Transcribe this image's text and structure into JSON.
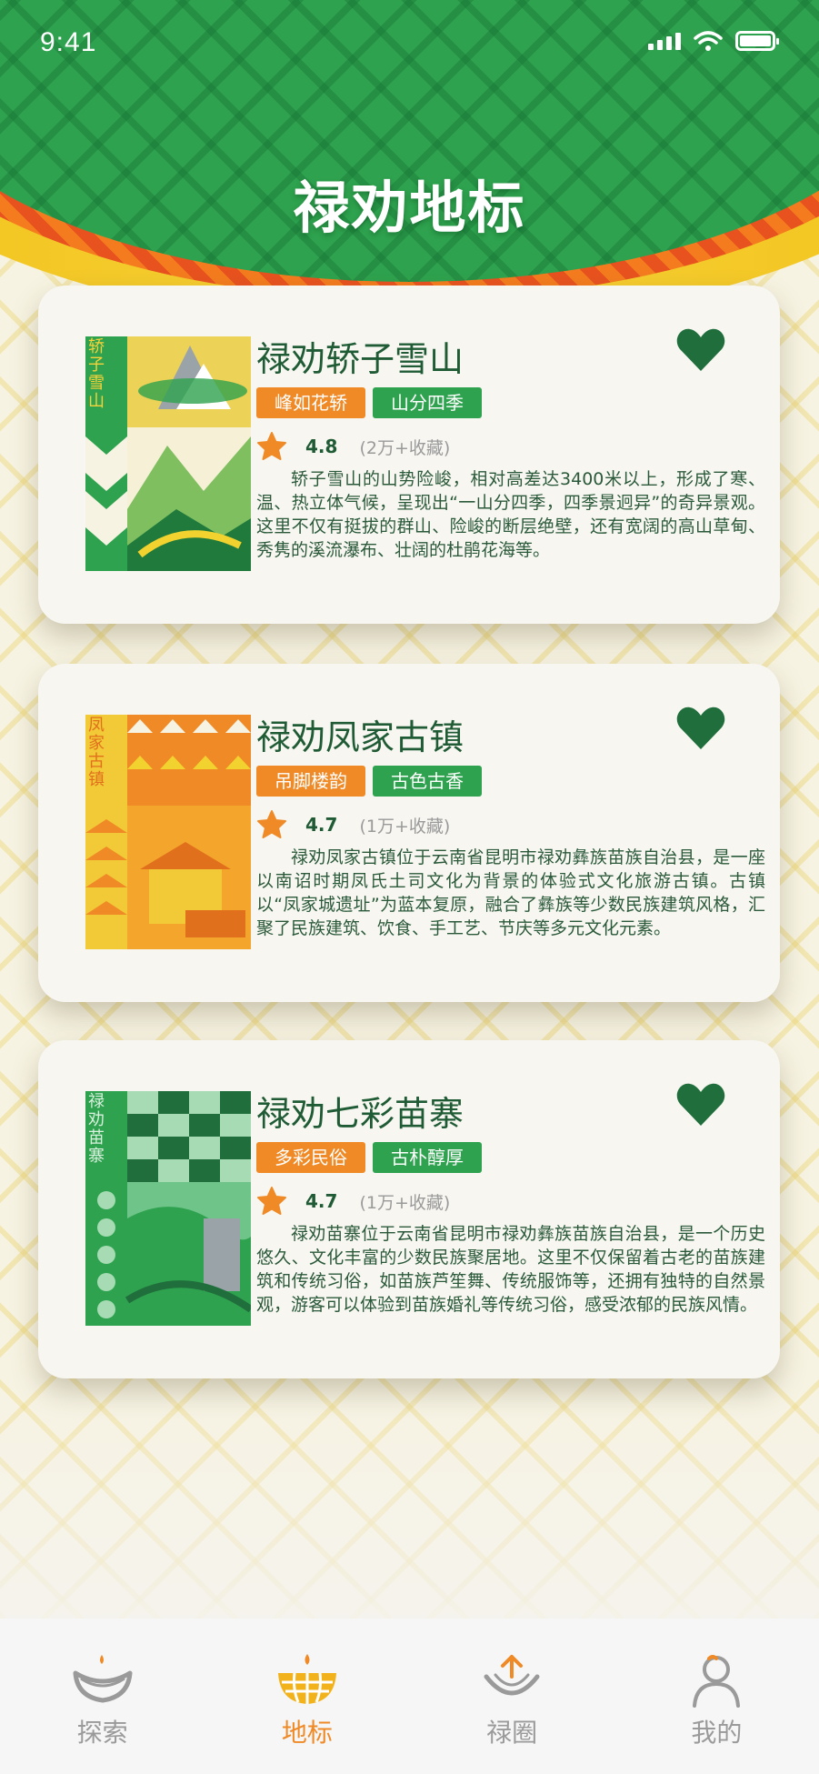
{
  "status_bar": {
    "time": "9:41"
  },
  "header": {
    "title": "禄劝地标"
  },
  "cards": [
    {
      "thumb_text": "轿子雪山",
      "title": "禄劝轿子雪山",
      "tags": [
        "峰如花轿",
        "山分四季"
      ],
      "rating": "4.8",
      "favorites": "(2万+收藏)",
      "description": "轿子雪山的山势险峻，相对高差达3400米以上，形成了寒、温、热立体气候，呈现出“一山分四季，四季景迥异”的奇异景观。这里不仅有挺拔的群山、险峻的断层绝壁，还有宽阔的高山草甸、秀隽的溪流瀑布、壮阔的杜鹃花海等。"
    },
    {
      "thumb_text": "凤家古镇",
      "title": "禄劝凤家古镇",
      "tags": [
        "吊脚楼韵",
        "古色古香"
      ],
      "rating": "4.7",
      "favorites": "(1万+收藏)",
      "description": "禄劝凤家古镇位于云南省昆明市禄劝彝族苗族自治县，是一座以南诏时期凤氏土司文化为背景的体验式文化旅游古镇。古镇以“凤家城遗址”为蓝本复原，融合了彝族等少数民族建筑风格，汇聚了民族建筑、饮食、手工艺、节庆等多元文化元素。"
    },
    {
      "thumb_text": "禄劝苗寨",
      "title": "禄劝七彩苗寨",
      "tags": [
        "多彩民俗",
        "古朴醇厚"
      ],
      "rating": "4.7",
      "favorites": "(1万+收藏)",
      "description": "禄劝苗寨位于云南省昆明市禄劝彝族苗族自治县，是一个历史悠久、文化丰富的少数民族聚居地。这里不仅保留着古老的苗族建筑和传统习俗，如苗族芦笙舞、传统服饰等，还拥有独特的自然景观，游客可以体验到苗族婚礼等传统习俗，感受浓郁的民族风情。"
    }
  ],
  "nav": {
    "items": [
      {
        "label": "探索",
        "icon": "explore-icon"
      },
      {
        "label": "地标",
        "icon": "landmark-icon"
      },
      {
        "label": "禄圈",
        "icon": "circle-share-icon"
      },
      {
        "label": "我的",
        "icon": "profile-icon"
      }
    ],
    "active": "地标"
  },
  "colors": {
    "brand_green": "#2ea24e",
    "dark_green": "#1f5b34",
    "accent_orange": "#ef8a26",
    "accent_yellow": "#f1c21a"
  }
}
